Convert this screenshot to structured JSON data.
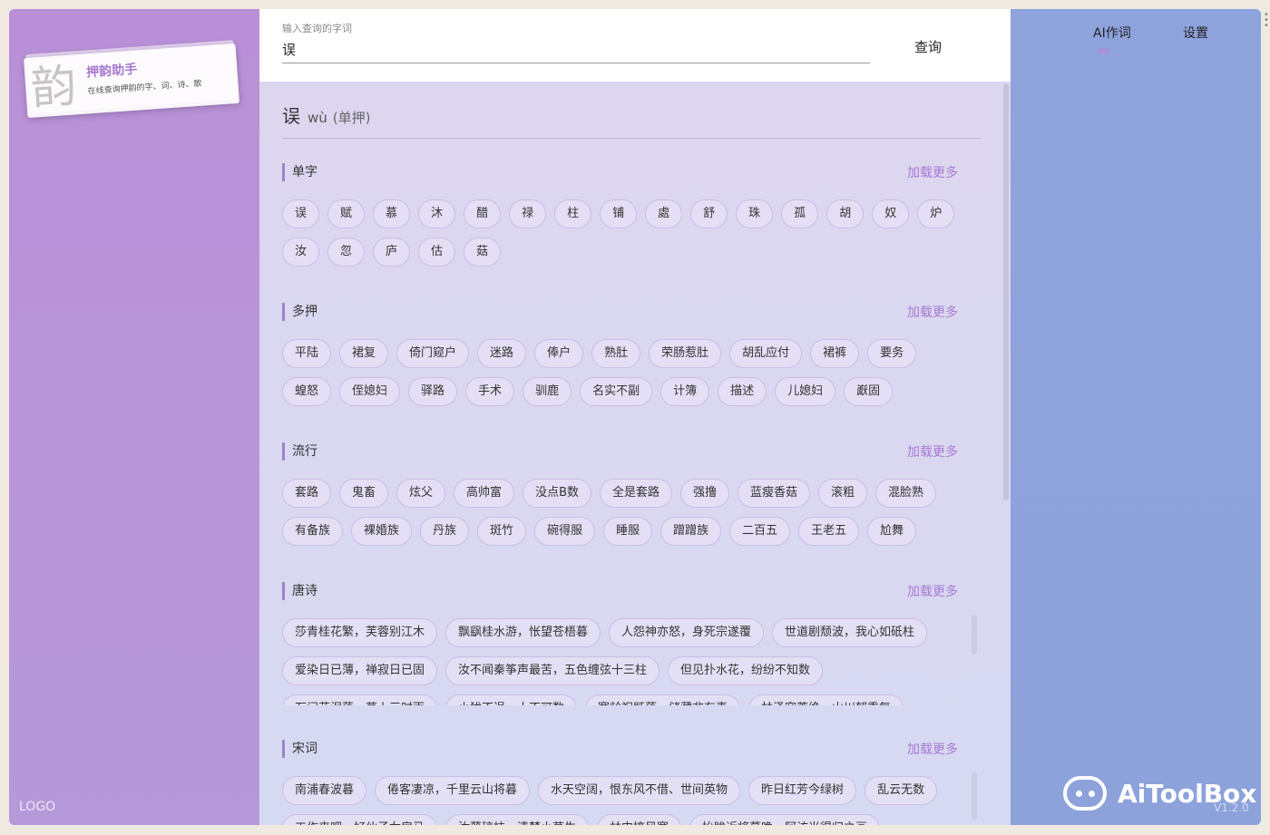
{
  "app": {
    "title": "押韵助手",
    "subtitle": "在线查询押韵的字、词、诗、歌",
    "logo_glyph": "韵",
    "left_logo": "LOGO"
  },
  "search": {
    "label": "输入查询的字词",
    "value": "误",
    "button": "查询"
  },
  "result": {
    "word": "误",
    "pinyin": "wù",
    "mode": "(单押)"
  },
  "load_more": "加载更多",
  "sections": [
    {
      "title": "单字",
      "items": [
        "误",
        "赋",
        "慕",
        "沐",
        "醋",
        "禄",
        "柱",
        "铺",
        "處",
        "舒",
        "珠",
        "孤",
        "胡",
        "奴",
        "炉",
        "汝",
        "忽",
        "庐",
        "估",
        "菇"
      ]
    },
    {
      "title": "多押",
      "items": [
        "平陆",
        "裙复",
        "倚门窥户",
        "迷路",
        "俸户",
        "熟肚",
        "荣肠惹肚",
        "胡乱应付",
        "裙裤",
        "要务",
        "蝗怒",
        "侄媳妇",
        "驿路",
        "手术",
        "驯鹿",
        "名实不副",
        "计簿",
        "描述",
        "儿媳妇",
        "巚固"
      ]
    },
    {
      "title": "流行",
      "items": [
        "套路",
        "鬼畜",
        "炫父",
        "高帅富",
        "没点B数",
        "全是套路",
        "强撸",
        "蓝瘦香菇",
        "滚粗",
        "混脸熟",
        "有备族",
        "裸婚族",
        "丹族",
        "斑竹",
        "碗得服",
        "睡服",
        "蹭蹭族",
        "二百五",
        "王老五",
        "尬舞"
      ]
    },
    {
      "title": "唐诗",
      "items": [
        "莎青桂花繁，芙蓉别江木",
        "飘飖桂水游，怅望苍梧暮",
        "人怨神亦怒，身死宗遂覆",
        "世道剧颓波，我心如砥柱",
        "爱染日已薄，禅寂日已固",
        "汝不闻秦筝声最苦，五色缠弦十三柱",
        "但见扑水花，纷纷不知数",
        "石问花泪落，草上三时雨",
        "小犹不逞，十不可数",
        "寒龄祝既落，储藏非有素",
        "林泽穷荒绝，山川郁重复"
      ]
    },
    {
      "title": "宋词",
      "items": [
        "南浦春波暮",
        "倦客凄凉，千里云山将暮",
        "水天空阔，恨东风不借、世间英物",
        "昨日红芳今绿树",
        "乱云无数",
        "工作来吧，好伙子女房马",
        "汝萼琼枝，清梦小草生",
        "林中掩风寒",
        "抬眸近将暮晚，阿访当得归之画"
      ]
    }
  ],
  "nav": {
    "ai": "AI作词",
    "ai_badge": "预览",
    "settings": "设置"
  },
  "brand": {
    "name": "AiToolBox",
    "version": "V1.2.0"
  }
}
